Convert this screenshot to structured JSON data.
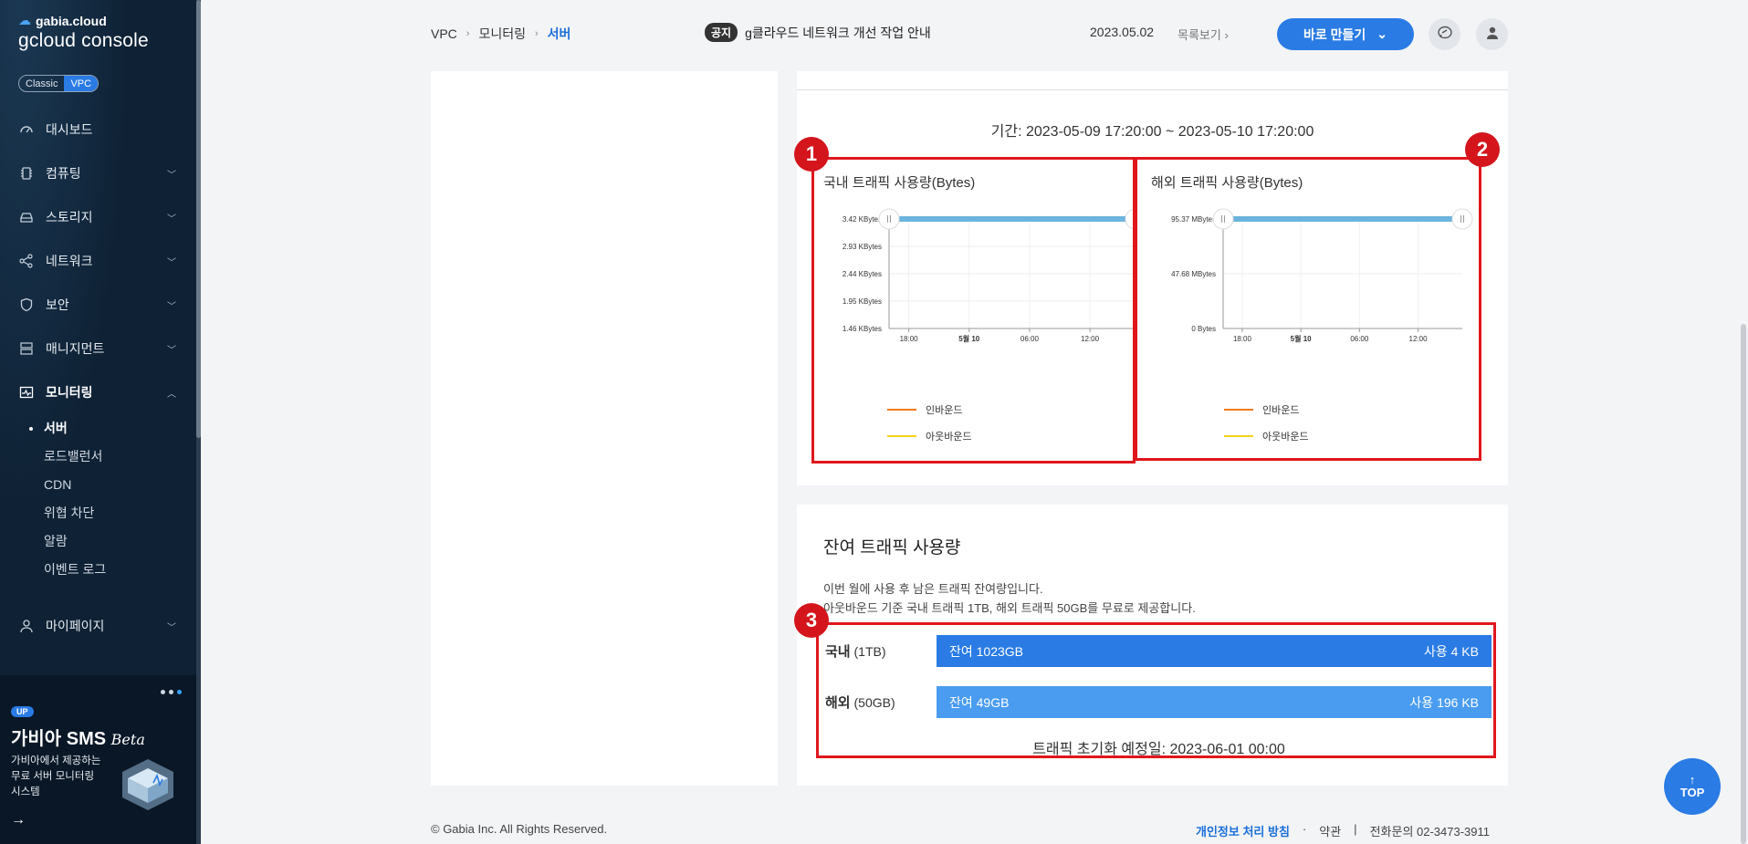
{
  "sidebar": {
    "brand_top": "gabia.cloud",
    "brand_main": "gcloud console",
    "mode_classic": "Classic",
    "mode_vpc": "VPC",
    "items": [
      {
        "label": "대시보드",
        "icon": "dashboard-icon"
      },
      {
        "label": "컴퓨팅",
        "icon": "chip-icon"
      },
      {
        "label": "스토리지",
        "icon": "storage-icon"
      },
      {
        "label": "네트워크",
        "icon": "network-icon"
      },
      {
        "label": "보안",
        "icon": "shield-icon"
      },
      {
        "label": "매니지먼트",
        "icon": "server-rack-icon"
      },
      {
        "label": "모니터링",
        "icon": "monitor-icon"
      }
    ],
    "monitoring_sub": [
      "서버",
      "로드밸런서",
      "CDN",
      "위협 차단",
      "알람",
      "이벤트 로그"
    ],
    "mypage": "마이페이지",
    "promo": {
      "badge": "UP",
      "title": "가비아 SMS",
      "title_suffix": "Beta",
      "desc_line1": "가비아에서 제공하는",
      "desc_line2": "무료 서버 모니터링",
      "desc_line3": "시스템"
    }
  },
  "header": {
    "breadcrumb": [
      "VPC",
      "모니터링",
      "서버"
    ],
    "notice_badge": "공지",
    "notice_text": "g클라우드 네트워크 개선 작업 안내",
    "notice_date": "2023.05.02",
    "notice_more": "목록보기",
    "create_button": "바로 만들기"
  },
  "charts_panel": {
    "period": "기간: 2023-05-09 17:20:00 ~ 2023-05-10 17:20:00",
    "markers": [
      "1",
      "2",
      "3"
    ],
    "legend_inbound": "인바운드",
    "legend_outbound": "아웃바운드",
    "colors": {
      "inbound": "#f07a1e",
      "outbound": "#f2d11a",
      "series": "#6ab4de"
    }
  },
  "chart_data": [
    {
      "type": "line",
      "title": "국내 트래픽 사용량(Bytes)",
      "y_ticks": [
        "3.42 KBytes",
        "2.93 KBytes",
        "2.44 KBytes",
        "1.95 KBytes",
        "1.46 KBytes"
      ],
      "x_ticks": [
        "18:00",
        "5월 10",
        "06:00",
        "12:00"
      ],
      "ylim": [
        1.46,
        3.42
      ],
      "yunit": "KBytes",
      "series": [
        {
          "name": "인바운드",
          "values": []
        },
        {
          "name": "아웃바운드",
          "values": []
        }
      ],
      "selection_value": 3.42
    },
    {
      "type": "line",
      "title": "해외 트래픽 사용량(Bytes)",
      "y_ticks": [
        "95.37 MBytes",
        "47.68 MBytes",
        "0 Bytes"
      ],
      "x_ticks": [
        "18:00",
        "5월 10",
        "06:00",
        "12:00"
      ],
      "ylim": [
        0,
        95.37
      ],
      "yunit": "MBytes",
      "series": [
        {
          "name": "인바운드",
          "values": []
        },
        {
          "name": "아웃바운드",
          "values": []
        }
      ],
      "selection_value": 95.37
    }
  ],
  "remaining": {
    "title": "잔여 트래픽 사용량",
    "desc_line1": "이번 월에 사용 후 남은 트래픽 잔여량입니다.",
    "desc_line2": "아웃바운드 기준 국내 트래픽 1TB, 해외 트래픽 50GB를 무료로 제공합니다.",
    "rows": [
      {
        "label": "국내",
        "quota": "(1TB)",
        "remain": "잔여 1023GB",
        "used": "사용 4 KB",
        "color": "#2a7be4"
      },
      {
        "label": "해외",
        "quota": "(50GB)",
        "remain": "잔여 49GB",
        "used": "사용 196 KB",
        "color": "#4a9cf0"
      }
    ],
    "reset": "트래픽 초기화 예정일: 2023-06-01 00:00"
  },
  "footer": {
    "copyright": "© Gabia Inc. All Rights Reserved.",
    "privacy": "개인정보 처리 방침",
    "dot": "·",
    "terms": "약관",
    "divider": "|",
    "contact": "전화문의  02-3473-3911"
  },
  "top_button": "TOP"
}
